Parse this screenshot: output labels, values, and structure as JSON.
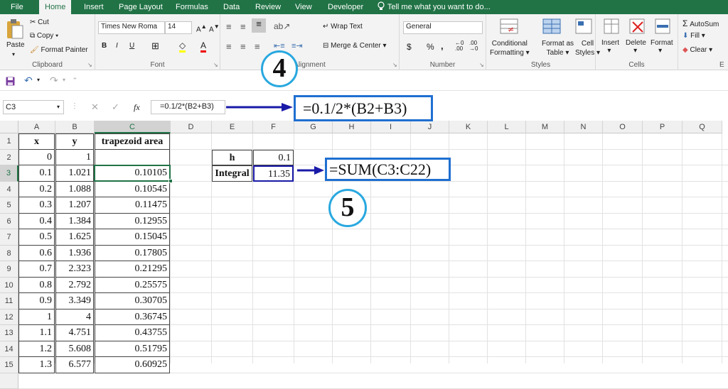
{
  "tabs": [
    {
      "label": "File",
      "active": false
    },
    {
      "label": "Home",
      "active": true
    },
    {
      "label": "Insert",
      "active": false
    },
    {
      "label": "Page Layout",
      "active": false
    },
    {
      "label": "Formulas",
      "active": false
    },
    {
      "label": "Data",
      "active": false
    },
    {
      "label": "Review",
      "active": false
    },
    {
      "label": "View",
      "active": false
    },
    {
      "label": "Developer",
      "active": false
    }
  ],
  "tell_me": "Tell me what you want to do...",
  "clipboard": {
    "paste": "Paste",
    "cut": "Cut",
    "copy": "Copy",
    "format_painter": "Format Painter",
    "label": "Clipboard"
  },
  "font": {
    "name": "Times New Roma",
    "size": "14",
    "bold": "B",
    "italic": "I",
    "underline": "U",
    "label": "Font"
  },
  "alignment": {
    "wrap_text": "Wrap Text",
    "merge_center": "Merge & Center",
    "label": "Alignment"
  },
  "number": {
    "format": "General",
    "currency": "$",
    "percent": "%",
    "comma": ",",
    "label": "Number"
  },
  "styles": {
    "conditional": [
      "Conditional",
      "Formatting"
    ],
    "format_table": [
      "Format as",
      "Table"
    ],
    "cell_styles": [
      "Cell",
      "Styles"
    ],
    "label": "Styles"
  },
  "cells": {
    "insert": "Insert",
    "delete": "Delete",
    "format": "Format",
    "label": "Cells"
  },
  "editing": {
    "autosum": "AutoSum",
    "fill": "Fill",
    "clear": "Clear",
    "label": "E"
  },
  "name_box": "C3",
  "fx": "fx",
  "formula": "=0.1/2*(B2+B3)",
  "callouts": {
    "step4": "4",
    "step5": "5",
    "formula_c3": "=0.1/2*(B2+B3)",
    "formula_f3": "=SUM(C3:C22)"
  },
  "columns": [
    "A",
    "B",
    "C",
    "D",
    "E",
    "F",
    "G",
    "H",
    "I",
    "J",
    "K",
    "L",
    "M",
    "N",
    "O",
    "P",
    "Q"
  ],
  "rows": [
    {
      "n": "1",
      "a": "x",
      "b": "y",
      "c": "trapezoid area"
    },
    {
      "n": "2",
      "a": "0",
      "b": "1",
      "c": ""
    },
    {
      "n": "3",
      "a": "0.1",
      "b": "1.021",
      "c": "0.10105"
    },
    {
      "n": "4",
      "a": "0.2",
      "b": "1.088",
      "c": "0.10545"
    },
    {
      "n": "5",
      "a": "0.3",
      "b": "1.207",
      "c": "0.11475"
    },
    {
      "n": "6",
      "a": "0.4",
      "b": "1.384",
      "c": "0.12955"
    },
    {
      "n": "7",
      "a": "0.5",
      "b": "1.625",
      "c": "0.15045"
    },
    {
      "n": "8",
      "a": "0.6",
      "b": "1.936",
      "c": "0.17805"
    },
    {
      "n": "9",
      "a": "0.7",
      "b": "2.323",
      "c": "0.21295"
    },
    {
      "n": "10",
      "a": "0.8",
      "b": "2.792",
      "c": "0.25575"
    },
    {
      "n": "11",
      "a": "0.9",
      "b": "3.349",
      "c": "0.30705"
    },
    {
      "n": "12",
      "a": "1",
      "b": "4",
      "c": "0.36745"
    },
    {
      "n": "13",
      "a": "1.1",
      "b": "4.751",
      "c": "0.43755"
    },
    {
      "n": "14",
      "a": "1.2",
      "b": "5.608",
      "c": "0.51795"
    },
    {
      "n": "15",
      "a": "1.3",
      "b": "6.577",
      "c": "0.60925"
    }
  ],
  "side_table": {
    "h_label": "h",
    "h_value": "0.1",
    "integral_label": "Integral",
    "integral_value": "11.35"
  },
  "colors": {
    "excel_green": "#217346",
    "callout_blue": "#1f6fd1",
    "circle_blue": "#29a8df",
    "arrow_blue": "#1a1aa8",
    "selection_green": "#217346"
  }
}
